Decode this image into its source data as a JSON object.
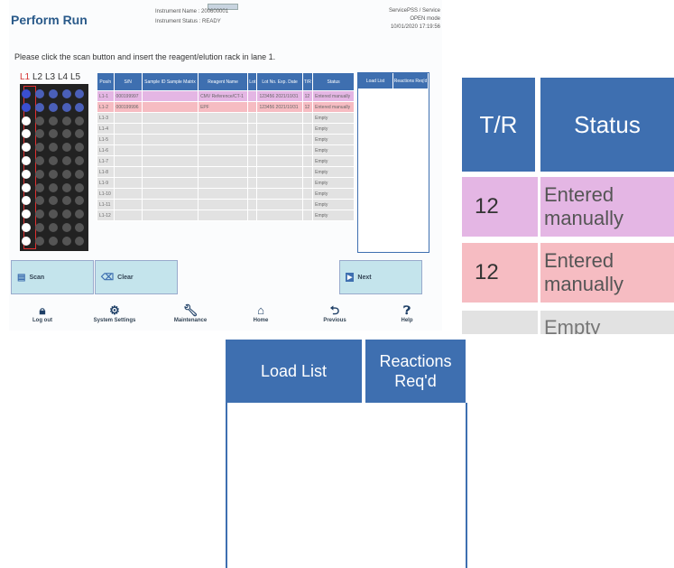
{
  "header": {
    "title": "Perform Run",
    "instrument_name": "Instrument Name : 200600001",
    "instrument_status": "Instrument Status : READY",
    "user": "ServicePSS / Service",
    "mode": "OPEN mode",
    "datetime": "10/01/2020 17:19:56"
  },
  "prompt": "Please click the scan button and insert the reagent/elution rack in lane 1.",
  "lanes": [
    "L1",
    "L2",
    "L3",
    "L4",
    "L5"
  ],
  "table": {
    "headers": [
      "Pos/n",
      "S/N",
      "Sample ID Sample Matrix",
      "Reagent Name",
      "Lot",
      "Lot No. Exp. Date",
      "T/R",
      "Status"
    ],
    "rows": [
      {
        "pos": "L1-1",
        "sn": "000199997",
        "sample": "",
        "reagent": "CMV Reference/CT-1",
        "lot": "",
        "lotno": "123456 2021/10/31",
        "tr": "12",
        "status": "Entered manually"
      },
      {
        "pos": "L1-2",
        "sn": "000199996",
        "sample": "",
        "reagent": "EPF",
        "lot": "",
        "lotno": "123456 2021/10/31",
        "tr": "12",
        "status": "Entered manually"
      },
      {
        "pos": "L1-3",
        "sn": "",
        "sample": "",
        "reagent": "",
        "lot": "",
        "lotno": "",
        "tr": "",
        "status": "Empty"
      },
      {
        "pos": "L1-4",
        "sn": "",
        "sample": "",
        "reagent": "",
        "lot": "",
        "lotno": "",
        "tr": "",
        "status": "Empty"
      },
      {
        "pos": "L1-5",
        "sn": "",
        "sample": "",
        "reagent": "",
        "lot": "",
        "lotno": "",
        "tr": "",
        "status": "Empty"
      },
      {
        "pos": "L1-6",
        "sn": "",
        "sample": "",
        "reagent": "",
        "lot": "",
        "lotno": "",
        "tr": "",
        "status": "Empty"
      },
      {
        "pos": "L1-7",
        "sn": "",
        "sample": "",
        "reagent": "",
        "lot": "",
        "lotno": "",
        "tr": "",
        "status": "Empty"
      },
      {
        "pos": "L1-8",
        "sn": "",
        "sample": "",
        "reagent": "",
        "lot": "",
        "lotno": "",
        "tr": "",
        "status": "Empty"
      },
      {
        "pos": "L1-9",
        "sn": "",
        "sample": "",
        "reagent": "",
        "lot": "",
        "lotno": "",
        "tr": "",
        "status": "Empty"
      },
      {
        "pos": "L1-10",
        "sn": "",
        "sample": "",
        "reagent": "",
        "lot": "",
        "lotno": "",
        "tr": "",
        "status": "Empty"
      },
      {
        "pos": "L1-11",
        "sn": "",
        "sample": "",
        "reagent": "",
        "lot": "",
        "lotno": "",
        "tr": "",
        "status": "Empty"
      },
      {
        "pos": "L1-12",
        "sn": "",
        "sample": "",
        "reagent": "",
        "lot": "",
        "lotno": "",
        "tr": "",
        "status": "Empty"
      }
    ]
  },
  "load_list": {
    "col1": "Load List",
    "col2": "Reactions Req'd"
  },
  "buttons": {
    "scan": "Scan",
    "clear": "Clear",
    "next": "Next"
  },
  "footer": {
    "logout": "Log out",
    "settings": "System Settings",
    "maintenance": "Maintenance",
    "home": "Home",
    "previous": "Previous",
    "help": "Help"
  },
  "zoom_right": {
    "tr_header": "T/R",
    "status_header": "Status",
    "row1_tr": "12",
    "row1_status": "Entered manually",
    "row2_tr": "12",
    "row2_status": "Entered manually",
    "row3_status": "Empty"
  },
  "zoom_bottom": {
    "load_list": "Load List",
    "reactions": "Reactions Req'd"
  },
  "colors": {
    "header_blue": "#3e6fb0",
    "pink1": "#e4b6e4",
    "pink2": "#f6bcc2",
    "button": "#c4e4ec",
    "active_lane": "#d43030"
  }
}
